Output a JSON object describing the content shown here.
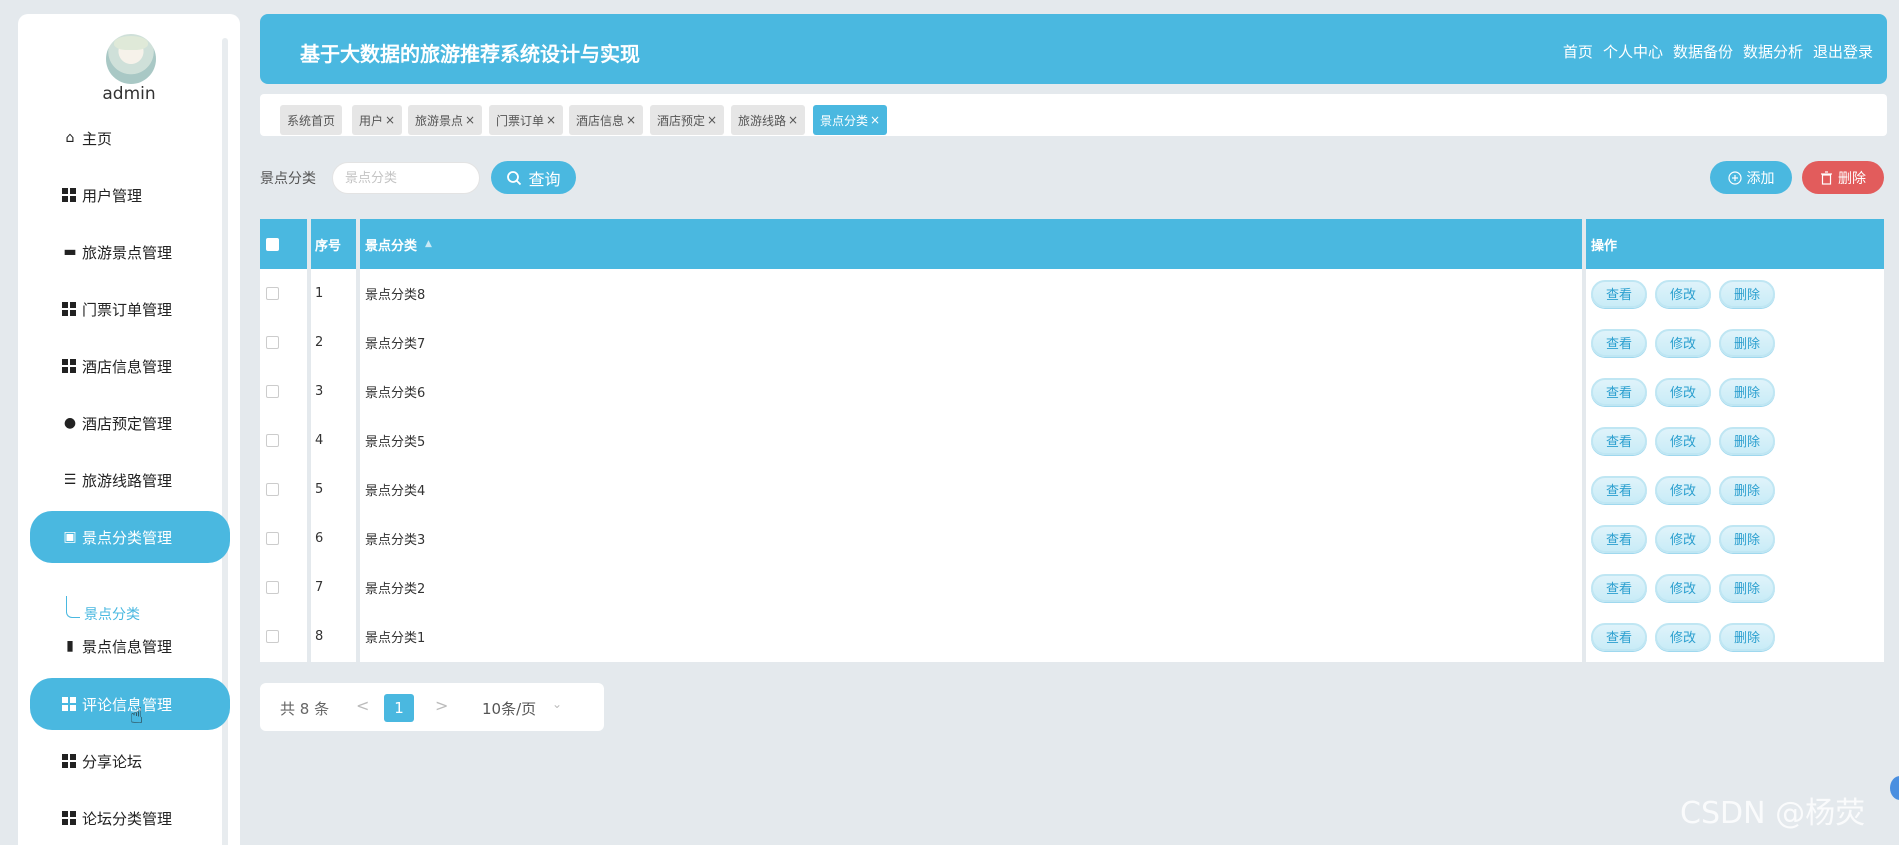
{
  "user": {
    "name": "admin"
  },
  "sidebar": {
    "items": [
      {
        "label": "主页",
        "icon": "home-icon",
        "active": false
      },
      {
        "label": "用户管理",
        "icon": "grid-icon",
        "active": false
      },
      {
        "label": "旅游景点管理",
        "icon": "briefcase-icon",
        "active": false
      },
      {
        "label": "门票订单管理",
        "icon": "grid-icon",
        "active": false
      },
      {
        "label": "酒店信息管理",
        "icon": "grid-icon",
        "active": false
      },
      {
        "label": "酒店预定管理",
        "icon": "user-icon",
        "active": false
      },
      {
        "label": "旅游线路管理",
        "icon": "list-icon",
        "active": false
      },
      {
        "label": "景点分类管理",
        "icon": "checkbox-icon",
        "active": true
      },
      {
        "label": "景点信息管理",
        "icon": "bar-chart-icon",
        "active": false
      },
      {
        "label": "评论信息管理",
        "icon": "grid-icon",
        "active": true
      },
      {
        "label": "分享论坛",
        "icon": "grid-icon",
        "active": false
      },
      {
        "label": "论坛分类管理",
        "icon": "grid-icon",
        "active": false
      }
    ],
    "sub_item": "景点分类"
  },
  "header": {
    "title": "基于大数据的旅游推荐系统设计与实现",
    "nav": [
      "首页",
      "个人中心",
      "数据备份",
      "数据分析",
      "退出登录"
    ]
  },
  "tabs": [
    {
      "label": "系统首页",
      "closable": false
    },
    {
      "label": "用户",
      "closable": true
    },
    {
      "label": "旅游景点",
      "closable": true
    },
    {
      "label": "门票订单",
      "closable": true
    },
    {
      "label": "酒店信息",
      "closable": true
    },
    {
      "label": "酒店预定",
      "closable": true
    },
    {
      "label": "旅游线路",
      "closable": true
    },
    {
      "label": "景点分类",
      "closable": true,
      "active": true
    }
  ],
  "tab_close_glyph": "×",
  "search": {
    "label": "景点分类",
    "placeholder": "景点分类",
    "query_label": "查询"
  },
  "actions": {
    "add_label": "添加",
    "delete_label": "删除"
  },
  "table": {
    "headers": {
      "index": "序号",
      "category": "景点分类",
      "ops": "操作"
    },
    "rows": [
      {
        "index": "1",
        "category": "景点分类8"
      },
      {
        "index": "2",
        "category": "景点分类7"
      },
      {
        "index": "3",
        "category": "景点分类6"
      },
      {
        "index": "4",
        "category": "景点分类5"
      },
      {
        "index": "5",
        "category": "景点分类4"
      },
      {
        "index": "6",
        "category": "景点分类3"
      },
      {
        "index": "7",
        "category": "景点分类2"
      },
      {
        "index": "8",
        "category": "景点分类1"
      }
    ],
    "row_ops": [
      "查看",
      "修改",
      "删除"
    ]
  },
  "pagination": {
    "total": "共 8 条",
    "prev": "<",
    "page": "1",
    "next": ">",
    "page_size": "10条/页"
  },
  "watermark": "CSDN @杨荧",
  "colors": {
    "primary": "#4ab8e0",
    "danger": "#e25c5c",
    "background": "#e4e9ed"
  }
}
